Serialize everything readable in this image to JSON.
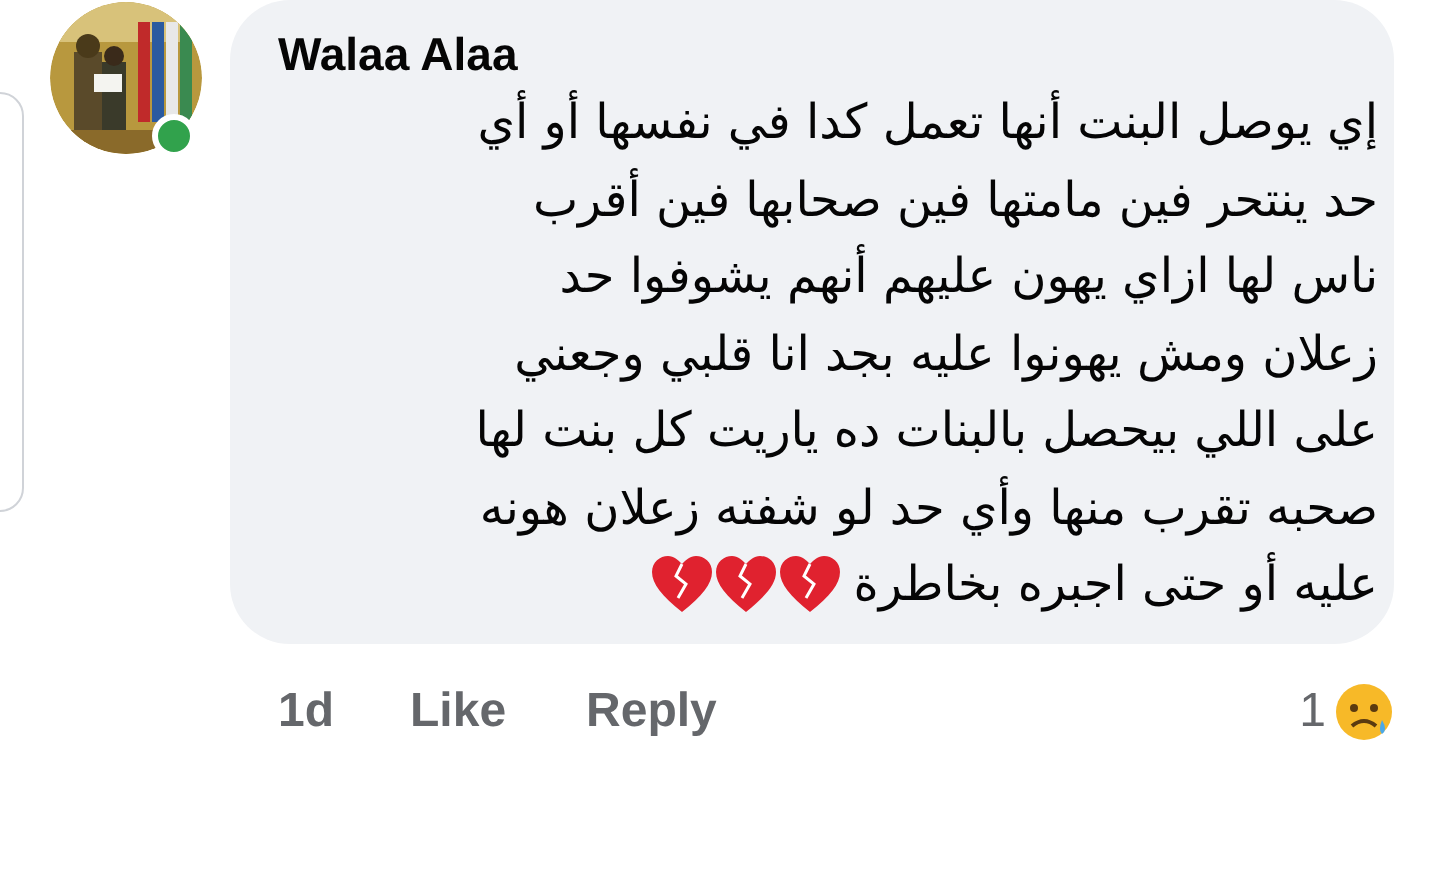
{
  "comment": {
    "author": "Walaa Alaa",
    "online": true,
    "lines": [
      "إي يوصل البنت أنها تعمل كدا في نفسها أو أي",
      "حد ينتحر فين مامتها فين صحابها فين أقرب",
      "ناس لها ازاي يهون عليهم أنهم يشوفوا حد",
      "زعلان ومش يهونوا عليه بجد انا قلبي وجعني",
      "على اللي بيحصل بالبنات ده ياريت كل بنت لها",
      "صحبه تقرب منها وأي حد لو شفته زعلان هونه",
      "عليه أو حتى اجبره بخاطرة"
    ],
    "time": "1d",
    "like_label": "Like",
    "reply_label": "Reply",
    "reaction_count": "1"
  }
}
